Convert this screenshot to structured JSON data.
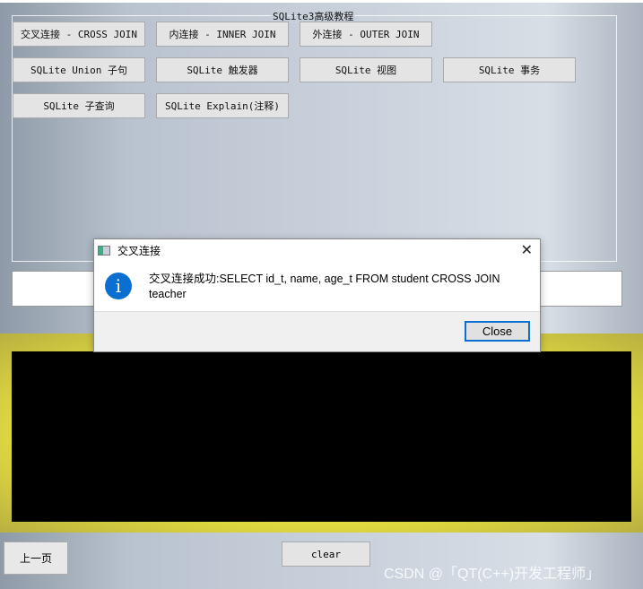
{
  "group_title": "SQLite3高级教程",
  "buttons": [
    "交叉连接 - CROSS JOIN",
    "内连接 - INNER JOIN",
    "外连接 - OUTER JOIN",
    "SQLite Union 子句",
    "SQLite 触发器",
    "SQLite 视图",
    "SQLite 事务",
    "SQLite 子查询",
    "SQLite Explain(注释)"
  ],
  "sql_input_value": "",
  "prev_label": "上一页",
  "clear_label": "clear",
  "watermark": "CSDN @「QT(C++)开发工程师」",
  "dialog": {
    "title": "交叉连接",
    "message": "交叉连接成功:SELECT id_t, name, age_t FROM student CROSS JOIN teacher",
    "close_label": "Close",
    "icon": "info-icon",
    "accent": "#0a6fd0"
  }
}
